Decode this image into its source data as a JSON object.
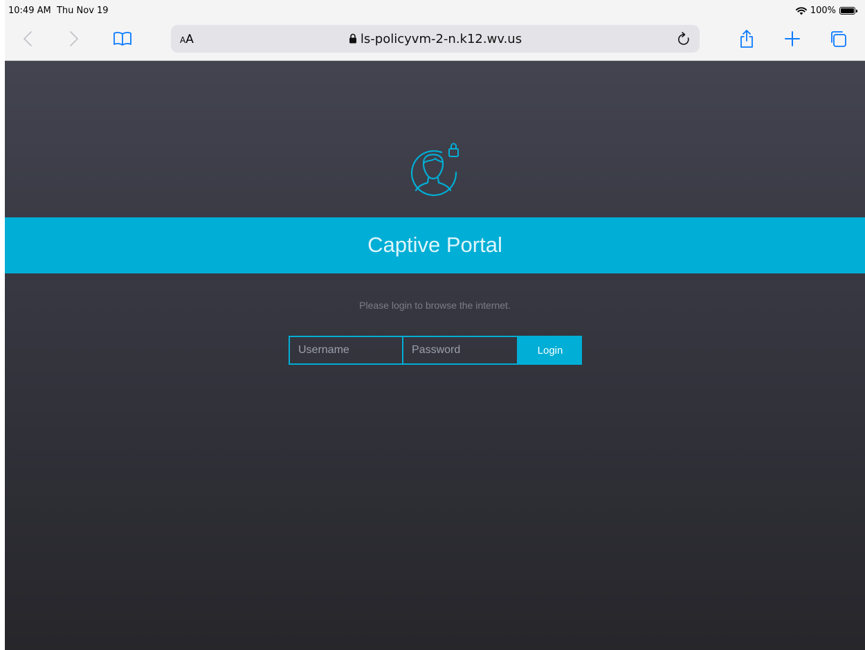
{
  "status_bar": {
    "time": "10:49 AM",
    "date": "Thu Nov 19",
    "battery_percent": "100%",
    "icons": [
      "wifi-icon",
      "battery-icon"
    ]
  },
  "toolbar": {
    "icons": [
      "back-icon",
      "forward-icon",
      "bookmarks-icon",
      "reader-aa-icon",
      "lock-icon",
      "reload-icon",
      "share-icon",
      "new-tab-icon",
      "tabs-icon"
    ],
    "reader_small": "A",
    "reader_large": "A",
    "url": "ls-policyvm-2-n.k12.wv.us"
  },
  "page": {
    "banner_title": "Captive Portal",
    "subtitle": "Please login to browse the internet.",
    "username_placeholder": "Username",
    "password_placeholder": "Password",
    "login_label": "Login",
    "icon": "user-lock-icon"
  },
  "colors": {
    "accent": "#00aed6",
    "page_bg_top": "#434450",
    "page_bg_bottom": "#26262b",
    "browser_chrome": "#f4f4f5"
  }
}
